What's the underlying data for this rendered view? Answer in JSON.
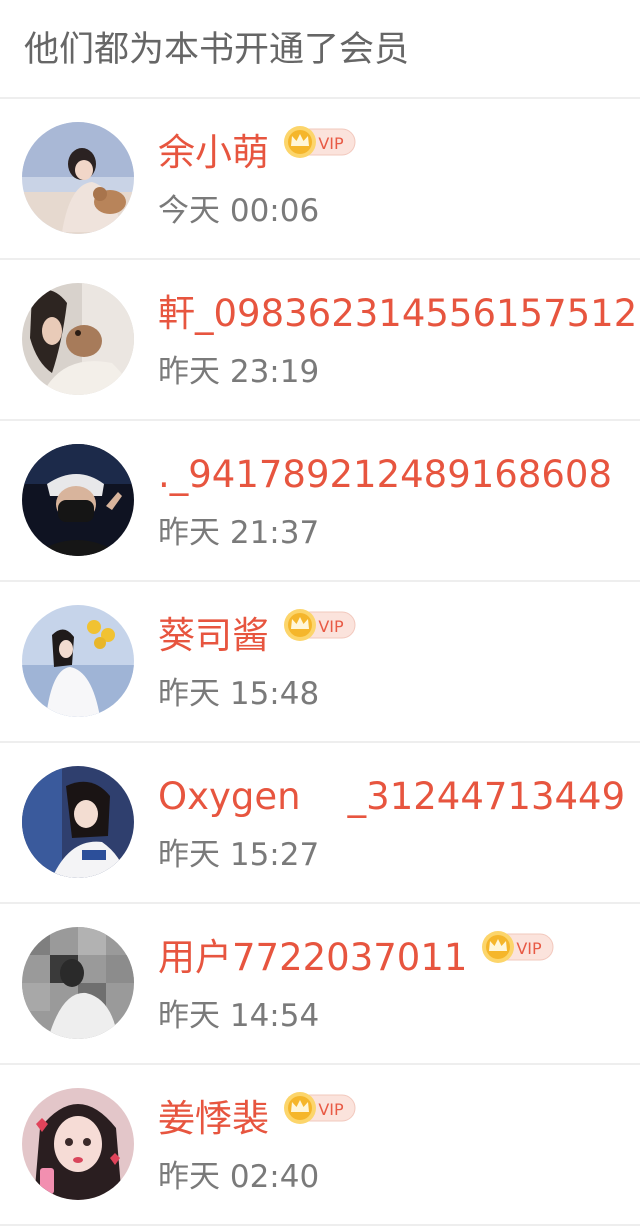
{
  "header": {
    "title": "他们都为本书开通了会员"
  },
  "badge": {
    "label": "VIP",
    "accent": "#e85a45",
    "crown": "#f5b62b"
  },
  "members": [
    {
      "name": "余小萌",
      "time": "今天 00:06",
      "vip": true,
      "avatar": "girl-with-cat-photo"
    },
    {
      "name": "軒_098362314556157512",
      "time": "昨天 23:19",
      "vip": false,
      "avatar": "girl-with-dog-photo"
    },
    {
      "name": "._9417892124891686​08",
      "time": "昨天 21:37",
      "vip": false,
      "avatar": "boy-in-mask-photo"
    },
    {
      "name": "葵司酱",
      "time": "昨天 15:48",
      "vip": true,
      "avatar": "girl-with-sunflowers-photo"
    },
    {
      "name": "Oxygen    _31244713449",
      "time": "昨天 15:27",
      "vip": false,
      "avatar": "two-girls-photo"
    },
    {
      "name": "用户7722037011",
      "time": "昨天 14:54",
      "vip": true,
      "avatar": "pixelated-girl-photo"
    },
    {
      "name": "姜悸裴",
      "time": "昨天 02:40",
      "vip": true,
      "avatar": "anime-style-girl-photo"
    }
  ]
}
